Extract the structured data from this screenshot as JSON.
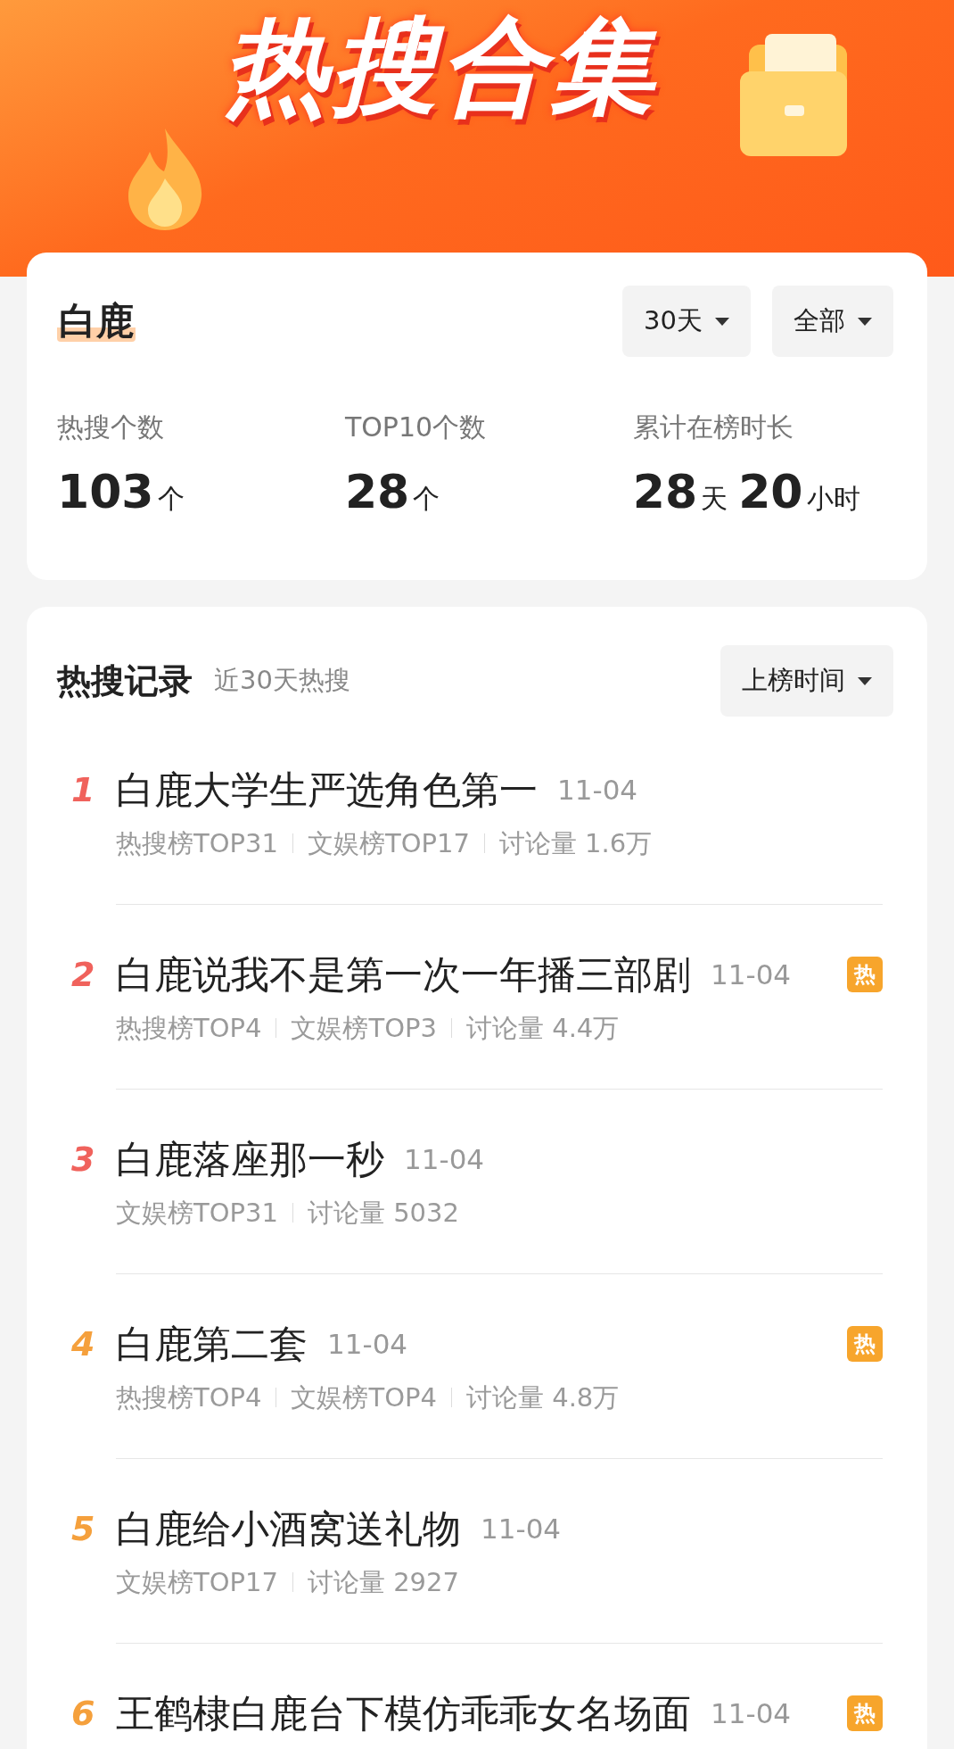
{
  "banner": {
    "title": "热搜合集"
  },
  "summary": {
    "name": "白鹿",
    "filters": [
      {
        "label": "30天"
      },
      {
        "label": "全部"
      }
    ],
    "stats": [
      {
        "label": "热搜个数",
        "parts": [
          {
            "value": "103",
            "unit": "个"
          }
        ]
      },
      {
        "label": "TOP10个数",
        "parts": [
          {
            "value": "28",
            "unit": "个"
          }
        ]
      },
      {
        "label": "累计在榜时长",
        "parts": [
          {
            "value": "28",
            "unit": "天"
          },
          {
            "value": "20",
            "unit": "小时"
          }
        ]
      }
    ]
  },
  "records": {
    "title": "热搜记录",
    "subtitle": "近30天热搜",
    "sort": {
      "label": "上榜时间"
    },
    "items": [
      {
        "rank": "1",
        "color": "#f0625c",
        "title": "白鹿大学生严选角色第一",
        "date": "11-04",
        "meta": [
          "热搜榜TOP31",
          "文娱榜TOP17",
          "讨论量 1.6万"
        ]
      },
      {
        "rank": "2",
        "color": "#f0625c",
        "title": "白鹿说我不是第一次一年播三部剧",
        "date": "11-04",
        "badge": "热",
        "meta": [
          "热搜榜TOP4",
          "文娱榜TOP3",
          "讨论量 4.4万"
        ]
      },
      {
        "rank": "3",
        "color": "#f0625c",
        "title": "白鹿落座那一秒",
        "date": "11-04",
        "meta": [
          "文娱榜TOP31",
          "讨论量 5032"
        ]
      },
      {
        "rank": "4",
        "color": "#f5a03c",
        "title": "白鹿第二套",
        "date": "11-04",
        "badge": "热",
        "meta": [
          "热搜榜TOP4",
          "文娱榜TOP4",
          "讨论量 4.8万"
        ]
      },
      {
        "rank": "5",
        "color": "#f5a03c",
        "title": "白鹿给小酒窝送礼物",
        "date": "11-04",
        "meta": [
          "文娱榜TOP17",
          "讨论量 2927"
        ]
      },
      {
        "rank": "6",
        "color": "#f5a03c",
        "title": "王鹤棣白鹿台下模仿乖乖女名场面",
        "date": "11-04",
        "badge": "热"
      }
    ]
  }
}
